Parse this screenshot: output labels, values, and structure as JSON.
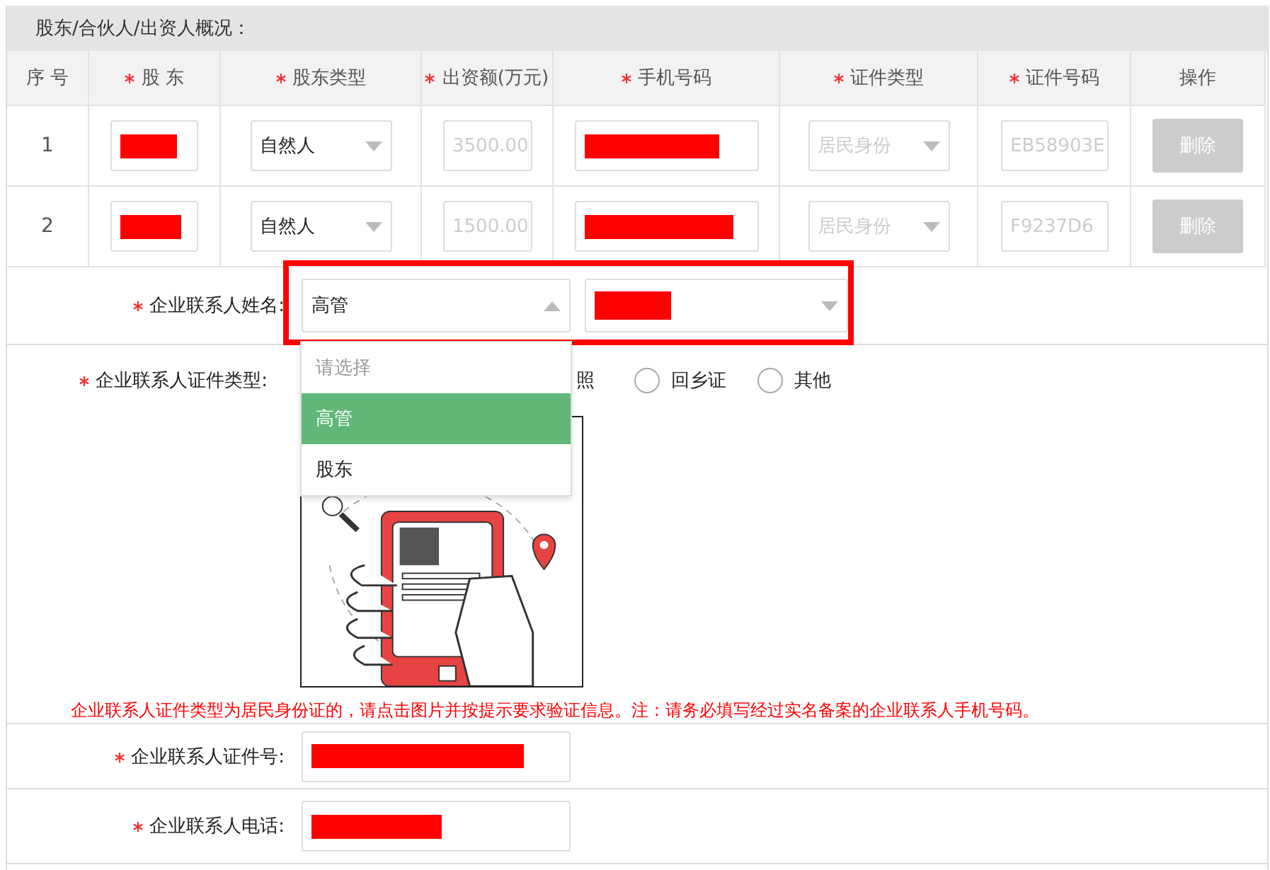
{
  "section_title": "股东/合伙人/出资人概况：",
  "table": {
    "columns": [
      {
        "label": "序 号",
        "required": false
      },
      {
        "label": "股 东",
        "required": true
      },
      {
        "label": "股东类型",
        "required": true
      },
      {
        "label": "出资额(万元)",
        "required": true
      },
      {
        "label": "手机号码",
        "required": true
      },
      {
        "label": "证件类型",
        "required": true
      },
      {
        "label": "证件号码",
        "required": true
      },
      {
        "label": "操作",
        "required": false
      }
    ],
    "rows": [
      {
        "index": "1",
        "shareholder_type": "自然人",
        "amount": "3500.00",
        "id_type": "居民身份",
        "id_number": "EB58903E",
        "action": {
          "label": "删除",
          "disabled": true
        }
      },
      {
        "index": "2",
        "shareholder_type": "自然人",
        "amount": "1500.00",
        "id_type": "居民身份",
        "id_number": "F9237D6",
        "action": {
          "label": "删除",
          "disabled": true
        }
      }
    ]
  },
  "contact_name": {
    "label": "企业联系人姓名:",
    "required": true,
    "highlighted": true,
    "role_select": {
      "value": "高管",
      "expanded": true
    },
    "options": [
      {
        "label": "请选择",
        "kind": "placeholder",
        "selected": false
      },
      {
        "label": "高管",
        "kind": "option",
        "selected": true
      },
      {
        "label": "股东",
        "kind": "option",
        "selected": false
      }
    ]
  },
  "contact_id_type": {
    "label": "企业联系人证件类型:",
    "required": true,
    "options": [
      {
        "label": "照",
        "kind": "clipped"
      },
      {
        "label": "回乡证",
        "kind": "radio",
        "selected": false
      },
      {
        "label": "其他",
        "kind": "radio",
        "selected": false
      }
    ]
  },
  "notice": "企业联系人证件类型为居民身份证的，请点击图片并按提示要求验证信息。注：请务必填写经过实名备案的企业联系人手机号码。",
  "contact_id_number": {
    "label": "企业联系人证件号:",
    "required": true
  },
  "contact_phone": {
    "label": "企业联系人电话:",
    "required": true
  }
}
